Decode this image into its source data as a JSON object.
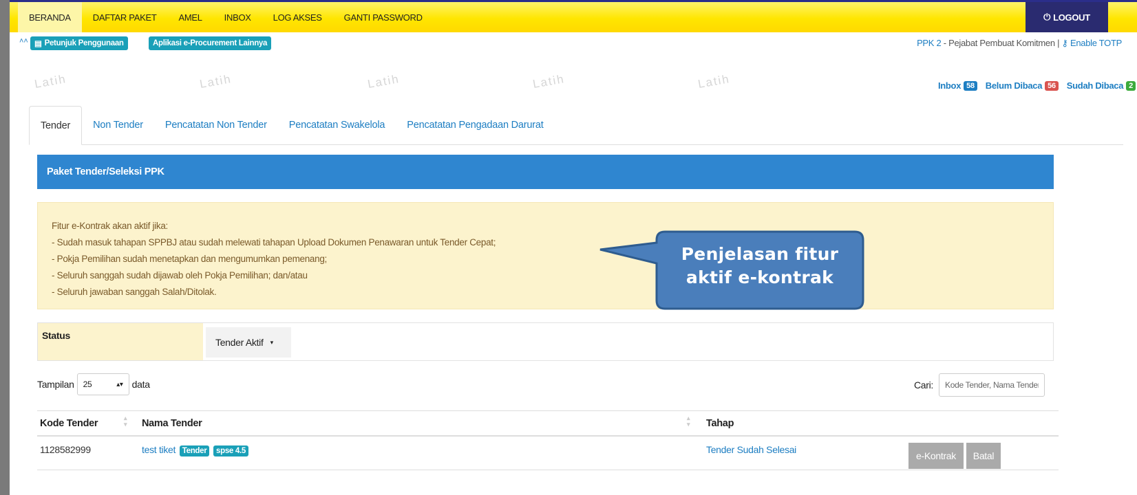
{
  "navbar": {
    "items": [
      "BERANDA",
      "DAFTAR PAKET",
      "AMEL",
      "INBOX",
      "LOG AKSES",
      "GANTI PASSWORD"
    ],
    "logout_label": "LOGOUT"
  },
  "subbar": {
    "guide_label": "Petunjuk Penggunaan",
    "other_apps_label": "Aplikasi e-Procurement Lainnya",
    "user_role": "PPK 2",
    "user_title": "Pejabat Pembuat Komitmen",
    "totp_label": "Enable TOTP"
  },
  "watermark": "Latih",
  "inbox": {
    "inbox_label": "Inbox",
    "inbox_count": "58",
    "unread_label": "Belum Dibaca",
    "unread_count": "56",
    "read_label": "Sudah Dibaca",
    "read_count": "2"
  },
  "tabs": [
    "Tender",
    "Non Tender",
    "Pencatatan Non Tender",
    "Pencatatan Swakelola",
    "Pencatatan Pengadaan Darurat"
  ],
  "panel_title": "Paket Tender/Seleksi PPK",
  "notice": {
    "heading": "Fitur e-Kontrak akan aktif jika:",
    "lines": [
      "- Sudah masuk tahapan SPPBJ atau sudah melewati tahapan Upload Dokumen Penawaran untuk Tender Cepat;",
      "- Pokja Pemilihan sudah menetapkan dan mengumumkan pemenang;",
      "- Seluruh sanggah sudah dijawab oleh Pokja Pemilihan; dan/atau",
      "- Seluruh jawaban sanggah Salah/Ditolak."
    ]
  },
  "callout": {
    "line1": "Penjelasan fitur",
    "line2": "aktif e-kontrak"
  },
  "status": {
    "label": "Status",
    "value": "Tender Aktif"
  },
  "list_controls": {
    "show_label": "Tampilan",
    "page_size": "25",
    "data_label": "data",
    "search_label": "Cari:",
    "search_placeholder": "Kode Tender, Nama Tender"
  },
  "table": {
    "headers": [
      "Kode Tender",
      "Nama Tender",
      "Tahap"
    ],
    "rows": [
      {
        "kode": "1128582999",
        "nama": "test tiket",
        "badge1": "Tender",
        "badge2": "spse 4.5",
        "tahap": "Tender Sudah Selesai",
        "action1": "e-Kontrak",
        "action2": "Batal"
      }
    ]
  },
  "colors": {
    "navbar_yellow": "#ffe600",
    "logout_navy": "#2a2b70",
    "panel_blue": "#2f86d0",
    "notice_bg": "#fcf3cd",
    "badge_teal": "#1aa0b8",
    "callout_fill": "#4a7ebb",
    "link_blue": "#1d7ec2"
  }
}
